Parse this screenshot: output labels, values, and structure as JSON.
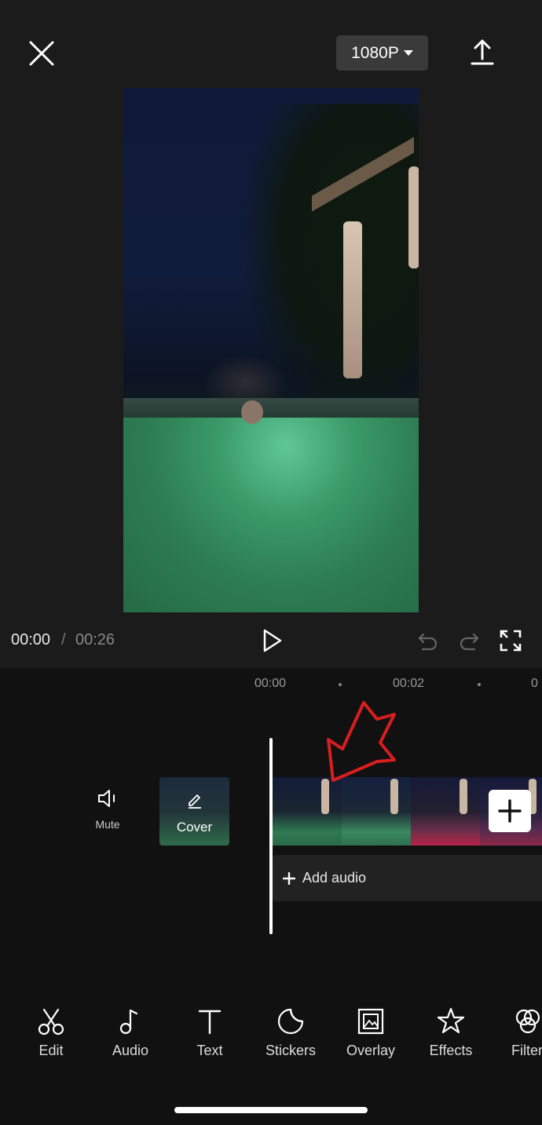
{
  "header": {
    "resolution_label": "1080P",
    "icons": [
      "close-icon",
      "caret-down-icon",
      "upload-icon"
    ]
  },
  "player": {
    "current_time": "00:00",
    "separator": "/",
    "total_time": "00:26",
    "icons": [
      "play-icon",
      "undo-icon",
      "redo-icon",
      "fullscreen-icon"
    ]
  },
  "timeline": {
    "ruler": [
      "00:00",
      "00:02"
    ],
    "mute_label": "Mute",
    "cover_label": "Cover",
    "add_audio_label": "Add audio",
    "annotation_color": "#d81e1e"
  },
  "toolbar": {
    "items": [
      {
        "label": "Edit",
        "icon": "scissors-icon"
      },
      {
        "label": "Audio",
        "icon": "music-note-icon"
      },
      {
        "label": "Text",
        "icon": "text-icon"
      },
      {
        "label": "Stickers",
        "icon": "sticker-icon"
      },
      {
        "label": "Overlay",
        "icon": "overlay-icon"
      },
      {
        "label": "Effects",
        "icon": "effects-star-icon"
      },
      {
        "label": "Filter",
        "icon": "filter-icon"
      }
    ]
  }
}
